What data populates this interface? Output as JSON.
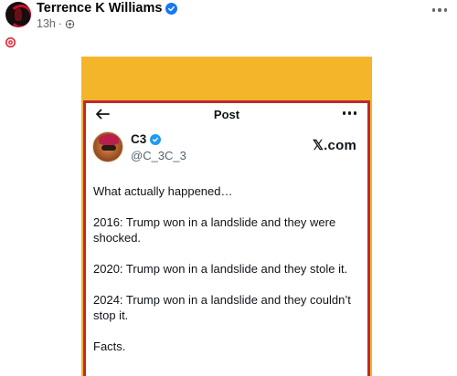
{
  "post": {
    "author": "Terrence K Williams",
    "time": "13h",
    "separator": "·",
    "caption_emoji": "target-emoji",
    "more_icon": "ellipsis-icon"
  },
  "tweet": {
    "header_title": "Post",
    "back_icon": "arrow-left-icon",
    "display_name": "C3",
    "handle": "@C_3C_3",
    "brand": "𝕏.com",
    "paragraphs": [
      "What actually happened…",
      "2016: Trump won in a landslide and they were shocked.",
      "2020: Trump won in a landslide and they stole it.",
      "2024: Trump won in a landslide and they couldn’t stop it.",
      "Facts."
    ]
  },
  "colors": {
    "image_background": "#f4b52b",
    "tweet_border": "#c0282d",
    "fb_verified": "#1877f2",
    "tw_verified": "#1d9bf0"
  }
}
